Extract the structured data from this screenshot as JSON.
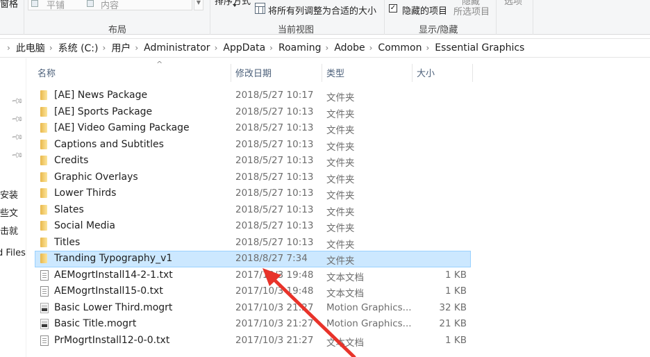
{
  "ribbon": {
    "pane_label_partial": "窗格",
    "layout_options": [
      "平铺",
      "内容"
    ],
    "layout_group": "布局",
    "sort_label_partial": "排序方式",
    "fit_columns": "将所有列调整为合适的大小",
    "current_view_group": "当前视图",
    "hidden_items": "隐藏的项目",
    "hidden_items_checked": true,
    "hide_selected": "所选项目",
    "hide_label_partial": "隐藏",
    "show_hide_group": "显示/隐藏",
    "options_partial": "选项"
  },
  "breadcrumb": [
    "此电脑",
    "系统 (C:)",
    "用户",
    "Administrator",
    "AppData",
    "Roaming",
    "Adobe",
    "Common",
    "Essential Graphics"
  ],
  "nav": {
    "pinned_count": 4,
    "partial_items": [
      "安装",
      "些文",
      "击就",
      "d Files"
    ]
  },
  "columns": {
    "name": "名称",
    "date": "修改日期",
    "type": "类型",
    "size": "大小"
  },
  "files": [
    {
      "name": "[AE] News Package",
      "date": "2018/5/27 10:17",
      "type": "文件夹",
      "size": "",
      "icon": "folder"
    },
    {
      "name": "[AE] Sports Package",
      "date": "2018/5/27 10:13",
      "type": "文件夹",
      "size": "",
      "icon": "folder"
    },
    {
      "name": "[AE] Video Gaming Package",
      "date": "2018/5/27 10:13",
      "type": "文件夹",
      "size": "",
      "icon": "folder"
    },
    {
      "name": "Captions and Subtitles",
      "date": "2018/5/27 10:13",
      "type": "文件夹",
      "size": "",
      "icon": "folder"
    },
    {
      "name": "Credits",
      "date": "2018/5/27 10:13",
      "type": "文件夹",
      "size": "",
      "icon": "folder"
    },
    {
      "name": "Graphic Overlays",
      "date": "2018/5/27 10:13",
      "type": "文件夹",
      "size": "",
      "icon": "folder"
    },
    {
      "name": "Lower Thirds",
      "date": "2018/5/27 10:13",
      "type": "文件夹",
      "size": "",
      "icon": "folder"
    },
    {
      "name": "Slates",
      "date": "2018/5/27 10:13",
      "type": "文件夹",
      "size": "",
      "icon": "folder"
    },
    {
      "name": "Social Media",
      "date": "2018/5/27 10:13",
      "type": "文件夹",
      "size": "",
      "icon": "folder"
    },
    {
      "name": "Titles",
      "date": "2018/5/27 10:13",
      "type": "文件夹",
      "size": "",
      "icon": "folder"
    },
    {
      "name": "Tranding Typography_v1",
      "date": "2018/8/27 7:34",
      "type": "文件夹",
      "size": "",
      "icon": "folder",
      "selected": true
    },
    {
      "name": "AEMogrtInstall14-2-1.txt",
      "date": "2017/10/3 19:48",
      "type": "文本文档",
      "size": "1 KB",
      "icon": "txt"
    },
    {
      "name": "AEMogrtInstall15-0.txt",
      "date": "2017/10/3 19:48",
      "type": "文本文档",
      "size": "1 KB",
      "icon": "txt"
    },
    {
      "name": "Basic Lower Third.mogrt",
      "date": "2017/10/3 21:27",
      "type": "Motion Graphics...",
      "size": "32 KB",
      "icon": "mogrt"
    },
    {
      "name": "Basic Title.mogrt",
      "date": "2017/10/3 21:27",
      "type": "Motion Graphics...",
      "size": "21 KB",
      "icon": "mogrt"
    },
    {
      "name": "PrMogrtInstall12-0-0.txt",
      "date": "2017/10/3 21:27",
      "type": "文本文档",
      "size": "1 KB",
      "icon": "txt"
    }
  ],
  "annotation": {
    "color": "#e8332a",
    "kind": "red-arrow"
  }
}
